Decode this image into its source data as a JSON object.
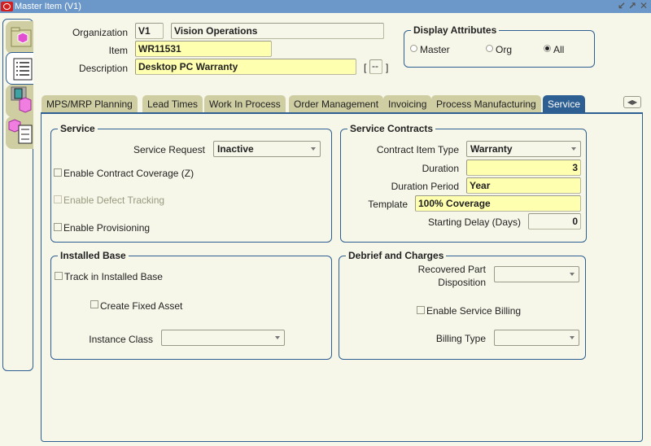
{
  "window": {
    "title": "Master Item (V1)",
    "controls": [
      "minimize-icon",
      "maximize-icon",
      "close-icon"
    ]
  },
  "header": {
    "organization_label": "Organization",
    "organization_code": "V1",
    "organization_name": "Vision Operations",
    "item_label": "Item",
    "item_value": "WR11531",
    "description_label": "Description",
    "description_value": "Desktop PC Warranty",
    "flex_button_label": "--",
    "flex_bracket_open": "[",
    "flex_bracket_close": "]"
  },
  "display_attributes": {
    "title": "Display Attributes",
    "options": [
      {
        "label": "Master",
        "selected": false
      },
      {
        "label": "Org",
        "selected": false
      },
      {
        "label": "All",
        "selected": true
      }
    ]
  },
  "side_tabs": [
    {
      "icon": "folder-cube-icon",
      "active": false
    },
    {
      "icon": "list-icon",
      "active": true
    },
    {
      "icon": "building-cube-icon",
      "active": false
    },
    {
      "icon": "cube-list-icon",
      "active": false
    }
  ],
  "tabs": [
    {
      "label": "MPS/MRP Planning",
      "active": false
    },
    {
      "label": "Lead Times",
      "active": false
    },
    {
      "label": "Work In Process",
      "active": false
    },
    {
      "label": "Order Management",
      "active": false
    },
    {
      "label": "Invoicing",
      "active": false
    },
    {
      "label": "Process Manufacturing",
      "active": false
    },
    {
      "label": "Service",
      "active": true
    }
  ],
  "service": {
    "title": "Service",
    "service_request_label": "Service Request",
    "service_request_value": "Inactive",
    "enable_contract_coverage_label": "Enable Contract Coverage (Z)",
    "enable_contract_coverage_checked": false,
    "enable_defect_tracking_label": "Enable Defect Tracking",
    "enable_defect_tracking_checked": false,
    "enable_provisioning_label": "Enable Provisioning",
    "enable_provisioning_checked": false
  },
  "service_contracts": {
    "title": "Service Contracts",
    "contract_item_type_label": "Contract Item Type",
    "contract_item_type_value": "Warranty",
    "duration_label": "Duration",
    "duration_value": "3",
    "duration_period_label": "Duration Period",
    "duration_period_value": "Year",
    "template_label": "Template",
    "template_value": "100% Coverage",
    "starting_delay_label": "Starting Delay (Days)",
    "starting_delay_value": "0"
  },
  "installed_base": {
    "title": "Installed Base",
    "track_label": "Track in Installed Base",
    "track_checked": false,
    "create_fixed_asset_label": "Create Fixed Asset",
    "create_fixed_asset_checked": false,
    "instance_class_label": "Instance Class",
    "instance_class_value": ""
  },
  "debrief": {
    "title": "Debrief and Charges",
    "recovered_part_label_1": "Recovered Part",
    "recovered_part_label_2": "Disposition",
    "recovered_part_value": "",
    "enable_service_billing_label": "Enable Service Billing",
    "enable_service_billing_checked": false,
    "billing_type_label": "Billing Type",
    "billing_type_value": ""
  },
  "colors": {
    "titlebar": "#6b98c9",
    "accent": "#2d5f92",
    "background": "#f6f6e9",
    "required_field": "#ffffb0",
    "tab_inactive": "#cfcda2"
  }
}
